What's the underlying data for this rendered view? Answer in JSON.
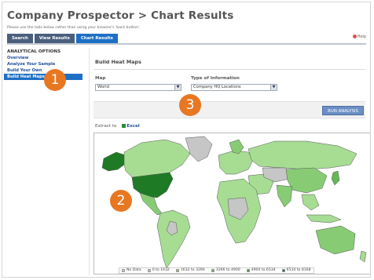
{
  "header": {
    "title": "Company Prospector > Chart Results",
    "notice": "Please use the tabs below rather than using your browser's 'back button'.",
    "help_label": "Help"
  },
  "tabs": [
    {
      "label": "Search",
      "active": false
    },
    {
      "label": "View Results",
      "active": false
    },
    {
      "label": "Chart Results",
      "active": true
    }
  ],
  "sidebar": {
    "heading": "ANALYTICAL OPTIONS",
    "items": [
      {
        "label": "Overview",
        "active": false
      },
      {
        "label": "Analyze Your Sample",
        "active": false
      },
      {
        "label": "Build Your Own",
        "active": false
      },
      {
        "label": "Build Heat Maps",
        "active": true
      }
    ]
  },
  "main": {
    "section_title": "Build Heat Maps",
    "map_label": "Map",
    "map_value": "World",
    "info_label": "Type of Information",
    "info_value": "Company HQ Locations",
    "run_button": "RUN ANALYSIS",
    "extract_label": "Extract to",
    "excel_label": "Excel"
  },
  "legend": [
    {
      "label": "No Data",
      "color": "#c6c6c6"
    },
    {
      "label": "0 to 1632",
      "color": "#a6dd93"
    },
    {
      "label": "1632 to 3266",
      "color": "#87cc74"
    },
    {
      "label": "3266 to 4900",
      "color": "#64b755"
    },
    {
      "label": "4900 to 6534",
      "color": "#3f9b39"
    },
    {
      "label": "6534 to 8168",
      "color": "#1f7a26"
    }
  ],
  "badges": [
    "1",
    "2",
    "3"
  ]
}
